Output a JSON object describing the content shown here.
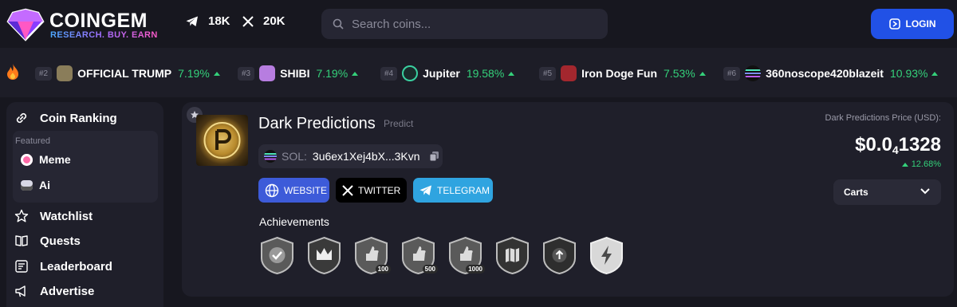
{
  "brand": {
    "name": "COINGEM",
    "tagline": "RESEARCH. BUY. EARN",
    "logo_icon": "gem-logo-icon"
  },
  "social": {
    "telegram_count": "18K",
    "x_count": "20K"
  },
  "search": {
    "placeholder": "Search coins..."
  },
  "header": {
    "login_label": "LOGIN"
  },
  "ticker": [
    {
      "rank": "#2",
      "name": "OFFICIAL TRUMP",
      "change": "7.19%"
    },
    {
      "rank": "#3",
      "name": "SHIBI",
      "change": "7.19%"
    },
    {
      "rank": "#4",
      "name": "Jupiter",
      "change": "19.58%"
    },
    {
      "rank": "#5",
      "name": "Iron Doge Fun",
      "change": "7.53%"
    },
    {
      "rank": "#6",
      "name": "360noscope420blazeit",
      "change": "10.93%"
    }
  ],
  "sidebar": {
    "coin_ranking": "Coin Ranking",
    "featured_label": "Featured",
    "featured": [
      {
        "label": "Meme"
      },
      {
        "label": "Ai"
      }
    ],
    "items": [
      {
        "label": "Watchlist"
      },
      {
        "label": "Quests"
      },
      {
        "label": "Leaderboard"
      },
      {
        "label": "Advertise"
      }
    ]
  },
  "coin": {
    "name": "Dark Predictions",
    "category": "Predict",
    "chain": "SOL:",
    "address": "3u6ex1Xej4bX...3Kvn",
    "buttons": {
      "website": "WEBSITE",
      "twitter": "TWITTER",
      "telegram": "TELEGRAM"
    },
    "achievements_label": "Achievements",
    "badges": [
      {
        "icon": "check-badge-icon",
        "count": ""
      },
      {
        "icon": "crown-badge-icon",
        "count": ""
      },
      {
        "icon": "thumbs-up-badge-icon",
        "count": "100"
      },
      {
        "icon": "thumbs-up-badge-icon",
        "count": "500"
      },
      {
        "icon": "thumbs-up-badge-icon",
        "count": "1000"
      },
      {
        "icon": "map-badge-icon",
        "count": ""
      },
      {
        "icon": "arrow-up-badge-icon",
        "count": ""
      },
      {
        "icon": "lightning-badge-icon",
        "count": ""
      }
    ],
    "price_label": "Dark Predictions Price (USD):",
    "price_prefix": "$0.0",
    "price_zeros": "4",
    "price_digits": "1328",
    "price_change": "12.68%",
    "dropdown_label": "Carts"
  },
  "colors": {
    "accent": "#2151e6",
    "positive": "#34d07a",
    "website": "#3d5bd9",
    "telegram": "#2fa4e0",
    "twitter": "#000000"
  }
}
